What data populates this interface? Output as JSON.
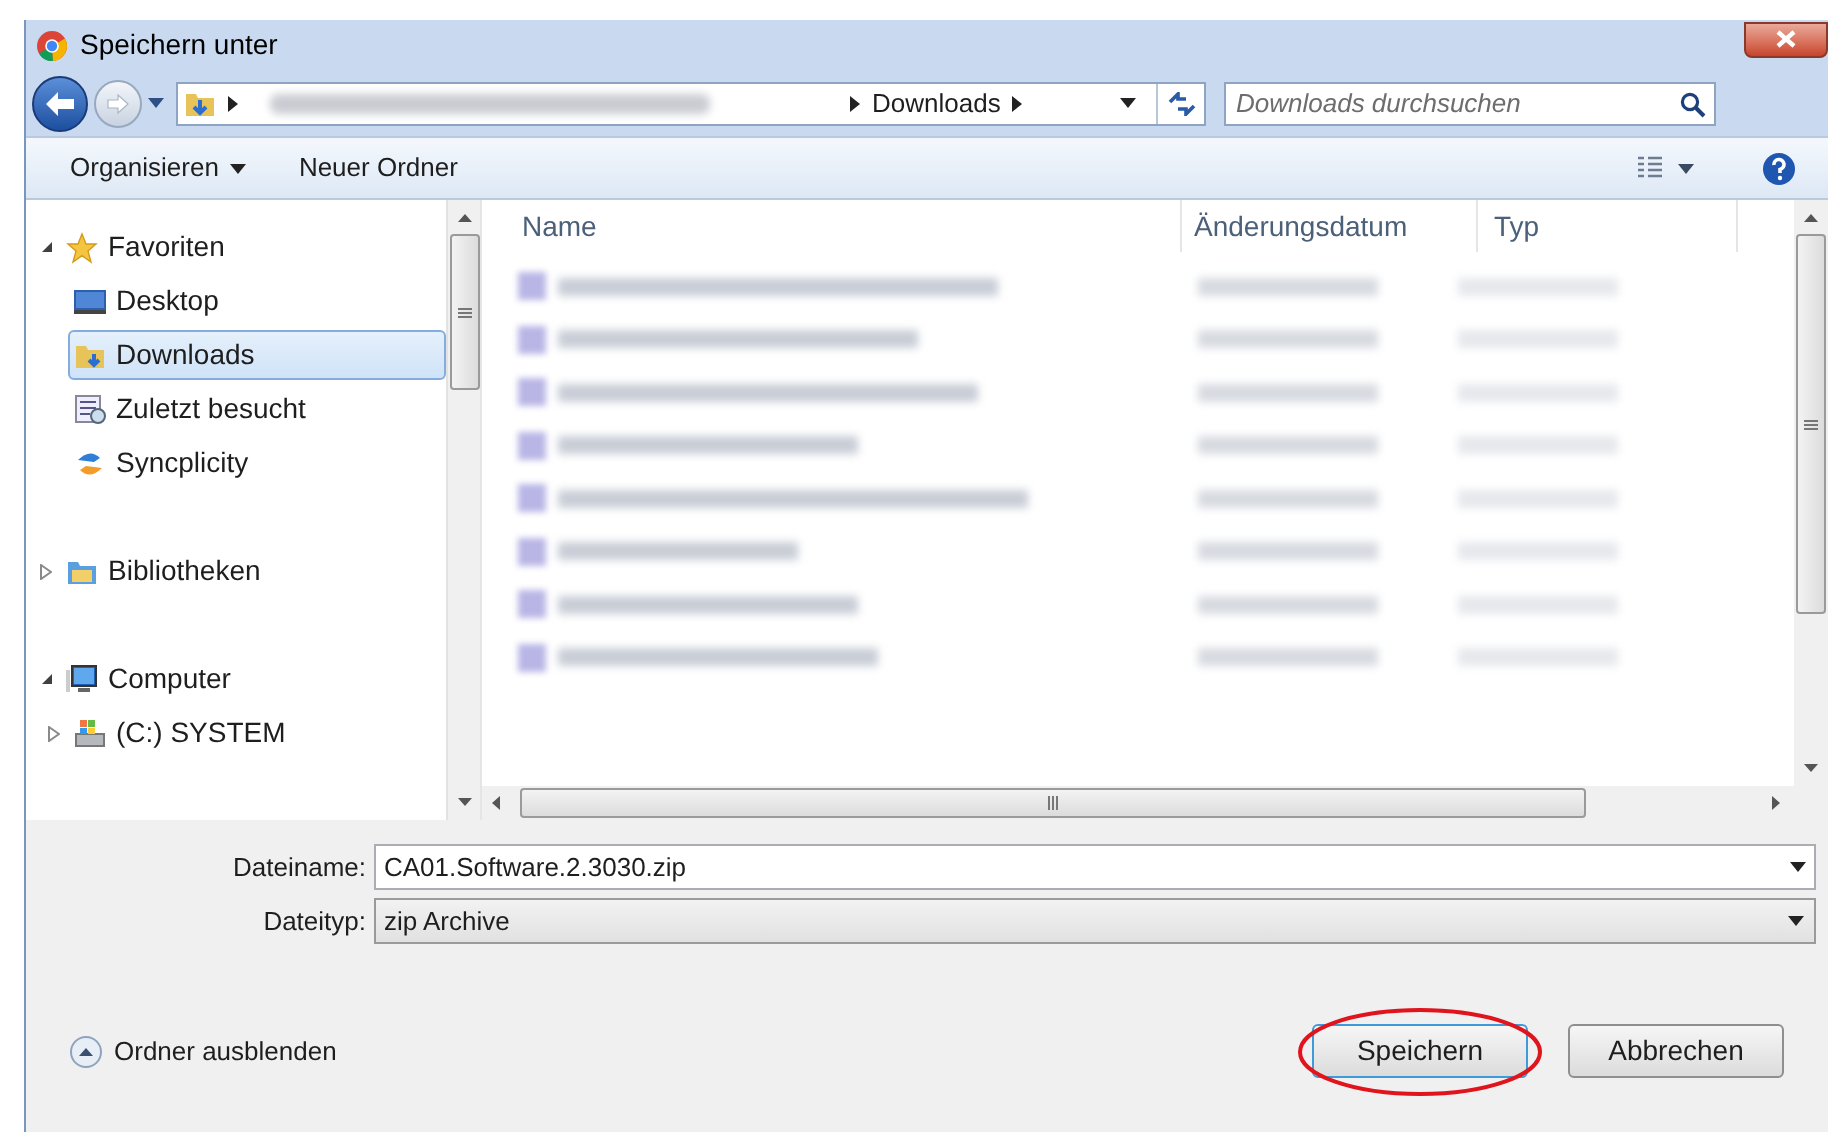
{
  "window": {
    "title": "Speichern unter"
  },
  "address_bar": {
    "current_folder": "Downloads"
  },
  "search": {
    "placeholder": "Downloads durchsuchen"
  },
  "toolbar": {
    "organize": "Organisieren",
    "new_folder": "Neuer Ordner"
  },
  "sidebar": {
    "items": [
      {
        "label": "Favoriten",
        "expanded": true,
        "selected": false,
        "children": [
          {
            "label": "Desktop",
            "selected": false
          },
          {
            "label": "Downloads",
            "selected": true
          },
          {
            "label": "Zuletzt besucht",
            "selected": false
          },
          {
            "label": "Syncplicity",
            "selected": false
          }
        ]
      },
      {
        "label": "Bibliotheken",
        "expanded": false,
        "selected": false
      },
      {
        "label": "Computer",
        "expanded": true,
        "selected": false,
        "children": [
          {
            "label": "(C:) SYSTEM",
            "expanded": false,
            "selected": false
          }
        ]
      }
    ]
  },
  "file_list": {
    "columns": [
      "Name",
      "Änderungsdatum",
      "Typ"
    ]
  },
  "filename": {
    "label": "Dateiname:",
    "value": "CA01.Software.2.3030.zip"
  },
  "filetype": {
    "label": "Dateityp:",
    "value": "zip Archive"
  },
  "hide_folders": "Ordner ausblenden",
  "buttons": [
    {
      "label": "Speichern",
      "default": true,
      "highlighted": true
    },
    {
      "label": "Abbrechen",
      "default": false,
      "highlighted": false
    }
  ]
}
